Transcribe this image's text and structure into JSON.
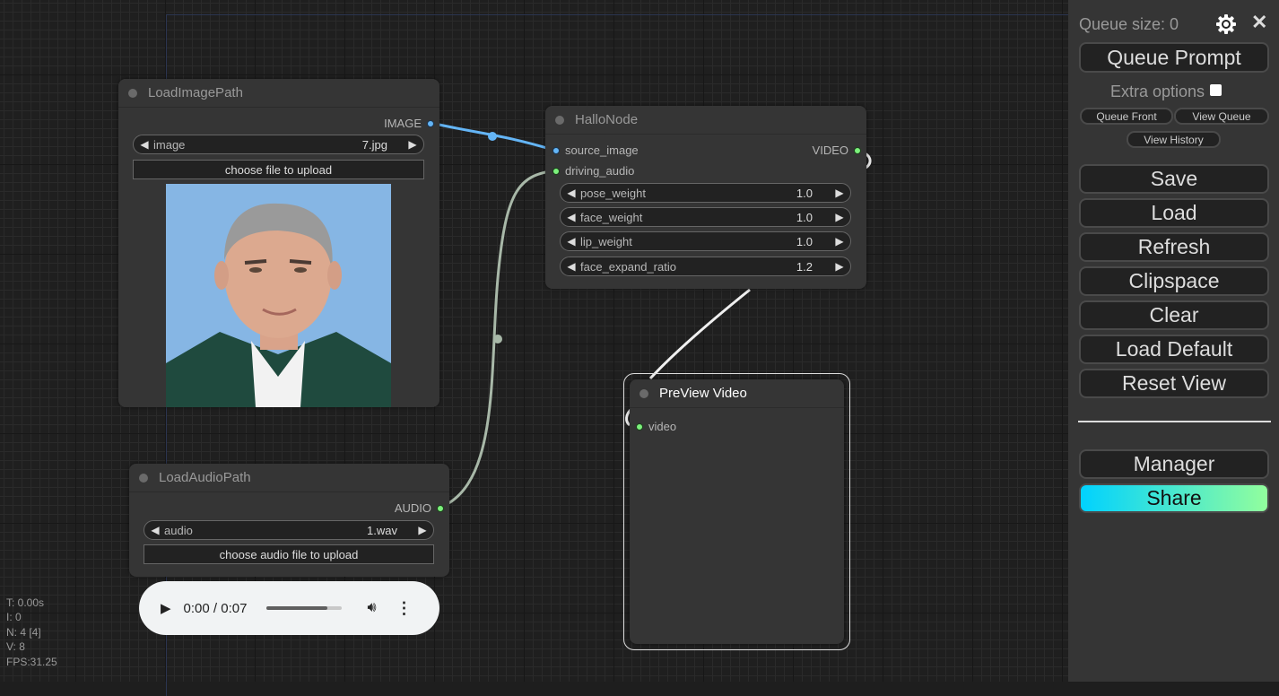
{
  "canvas": {
    "stats": [
      "T: 0.00s",
      "I: 0",
      "N: 4 [4]",
      "V: 8",
      "FPS:31.25"
    ]
  },
  "nodes": {
    "load_image": {
      "title": "LoadImagePath",
      "output_label": "IMAGE",
      "widget": {
        "label": "image",
        "value": "7.jpg"
      },
      "upload_label": "choose file to upload",
      "preview_alt": "portrait photo preview"
    },
    "hallo": {
      "title": "HalloNode",
      "inputs": [
        {
          "label": "source_image",
          "type": "IMAGE"
        },
        {
          "label": "driving_audio",
          "type": "AUDIO"
        }
      ],
      "output_label": "VIDEO",
      "widgets": [
        {
          "label": "pose_weight",
          "value": "1.0"
        },
        {
          "label": "face_weight",
          "value": "1.0"
        },
        {
          "label": "lip_weight",
          "value": "1.0"
        },
        {
          "label": "face_expand_ratio",
          "value": "1.2"
        }
      ]
    },
    "load_audio": {
      "title": "LoadAudioPath",
      "output_label": "AUDIO",
      "widget": {
        "label": "audio",
        "value": "1.wav"
      },
      "upload_label": "choose audio file to upload",
      "player": {
        "time": "0:00 / 0:07",
        "volume_fraction": 0.8
      }
    },
    "preview_video": {
      "title": "PreView Video",
      "input_label": "video"
    }
  },
  "links_colors": {
    "image": "#64b5f6",
    "audio": "#a8b8a8",
    "video": "#e8e8e8"
  },
  "panel": {
    "queue_size": "Queue size: 0",
    "queue_prompt": "Queue Prompt",
    "extra_options": "Extra options",
    "queue_front": "Queue Front",
    "view_queue": "View Queue",
    "view_history": "View History",
    "buttons": [
      "Save",
      "Load",
      "Refresh",
      "Clipspace",
      "Clear",
      "Load Default",
      "Reset View"
    ],
    "manager": "Manager",
    "share": "Share",
    "close_glyph": "✕"
  }
}
